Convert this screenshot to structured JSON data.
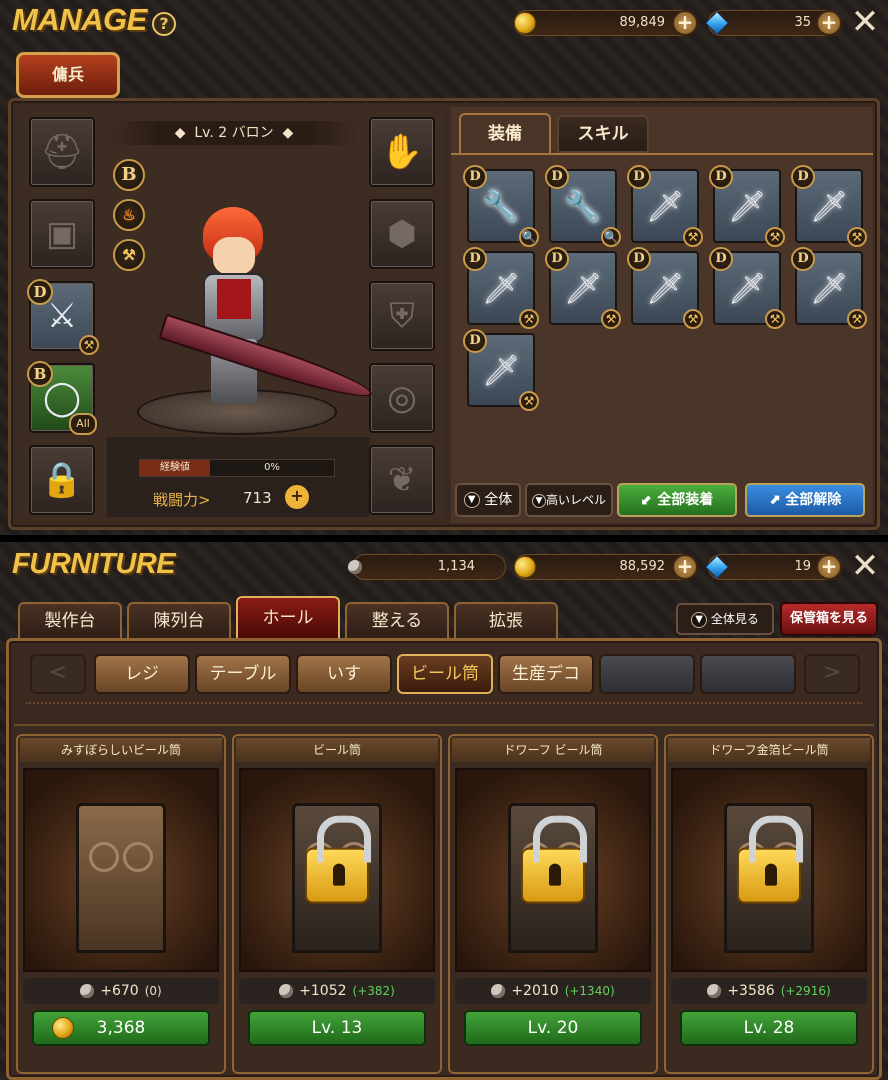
{
  "manage": {
    "title": "MANAGE",
    "help": "?",
    "gold": "89,849",
    "gems": "35",
    "plus": "+",
    "close": "✕",
    "tab_mercenary": "傭兵",
    "hero_name": "Lv. 2 バロン",
    "grade": "B",
    "exp_label": "経験値",
    "exp_value": "0%",
    "exp_fraction": 0,
    "power_label": "戦闘力>",
    "power_value": "713",
    "equip_left": [
      {
        "icon": "helmet-icon",
        "glyph": "⛑",
        "badge": ""
      },
      {
        "icon": "armor-icon",
        "glyph": "▣",
        "badge": ""
      },
      {
        "icon": "weapon-icon",
        "glyph": "⚔",
        "badge": "D"
      },
      {
        "icon": "ring-icon",
        "glyph": "◯",
        "badge": "B",
        "tag": "All"
      },
      {
        "icon": "lock-icon",
        "glyph": "🔒",
        "badge": ""
      }
    ],
    "equip_right": [
      {
        "icon": "gauntlet-icon",
        "glyph": "✋"
      },
      {
        "icon": "boot-icon",
        "glyph": "⬢"
      },
      {
        "icon": "shield-icon",
        "glyph": "⛨"
      },
      {
        "icon": "bracelet-icon",
        "glyph": "◎"
      },
      {
        "icon": "wings-icon",
        "glyph": "❦"
      }
    ],
    "tabs": [
      "装備",
      "スキル"
    ],
    "items": [
      {
        "grade": "D",
        "glyph": "🔧",
        "sub": "🔍"
      },
      {
        "grade": "D",
        "glyph": "🔧",
        "sub": "🔍"
      },
      {
        "grade": "D",
        "glyph": "🗡",
        "sub": "⚒"
      },
      {
        "grade": "D",
        "glyph": "🗡",
        "sub": "⚒"
      },
      {
        "grade": "D",
        "glyph": "🗡",
        "sub": "⚒"
      },
      {
        "grade": "D",
        "glyph": "🗡",
        "sub": "⚒"
      },
      {
        "grade": "D",
        "glyph": "🗡",
        "sub": "⚒"
      },
      {
        "grade": "D",
        "glyph": "🗡",
        "sub": "⚒"
      },
      {
        "grade": "D",
        "glyph": "🗡",
        "sub": "⚒"
      },
      {
        "grade": "D",
        "glyph": "🗡",
        "sub": "⚒"
      },
      {
        "grade": "D",
        "glyph": "🗡",
        "sub": "⚒"
      }
    ],
    "filter_all": "全体",
    "filter_high": "高いレベル",
    "equip_all": "全部装着",
    "unequip_all": "全部解除"
  },
  "furniture": {
    "title": "FURNITURE",
    "material": "1,134",
    "gold": "88,592",
    "gems": "19",
    "tabs": [
      "製作台",
      "陳列台",
      "ホール",
      "整える",
      "拡張"
    ],
    "active_tab": 2,
    "view_all": "全体見る",
    "storage": "保管箱を見る",
    "categories": [
      "レジ",
      "テーブル",
      "いす",
      "ビール筒",
      "生産デコ",
      "",
      ""
    ],
    "active_category": 3,
    "prev": "<",
    "next": ">",
    "cards": [
      {
        "name": "みすぼらしいビール筒",
        "stat": "+670",
        "bonus": "(0)",
        "bonus_color": "#e6dcc7",
        "button": "3,368",
        "locked": false,
        "coin": true
      },
      {
        "name": "ビール筒",
        "stat": "+1052",
        "bonus": "(+382)",
        "bonus_color": "#5fd35a",
        "button": "Lv. 13",
        "locked": true,
        "coin": false
      },
      {
        "name": "ドワーフ ビール筒",
        "stat": "+2010",
        "bonus": "(+1340)",
        "bonus_color": "#5fd35a",
        "button": "Lv. 20",
        "locked": true,
        "coin": false
      },
      {
        "name": "ドワーフ金箔ビール筒",
        "stat": "+3586",
        "bonus": "(+2916)",
        "bonus_color": "#5fd35a",
        "button": "Lv. 28",
        "locked": true,
        "coin": false
      }
    ]
  },
  "colors": {
    "accent": "#f0c24a",
    "green": "#2e8a28",
    "blue": "#2a71c4",
    "red": "#8f1c1c"
  }
}
